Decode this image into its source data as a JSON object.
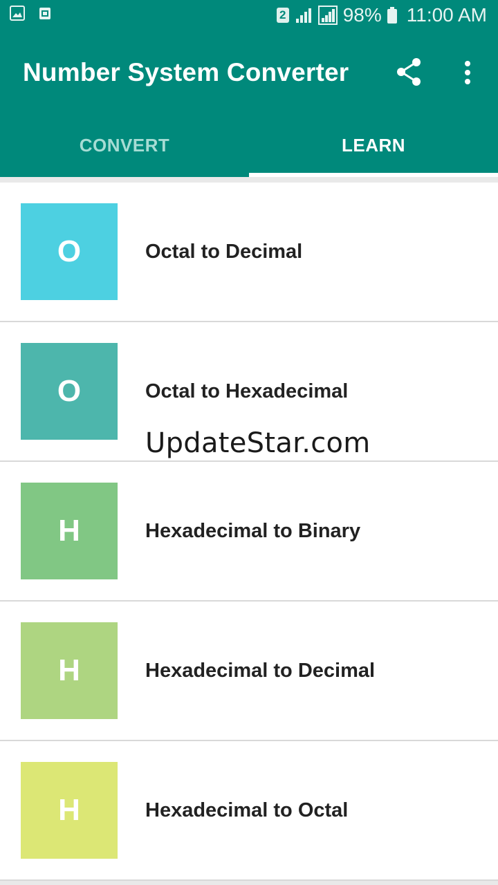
{
  "status_bar": {
    "sim_slot": "2",
    "battery": "98%",
    "time": "11:00 AM",
    "icons": [
      "gallery-icon",
      "app-notification-icon",
      "signal-icon",
      "signal-icon-2",
      "battery-icon"
    ]
  },
  "app_bar": {
    "title": "Number System Converter",
    "actions": [
      "share-icon",
      "more-vert-icon"
    ],
    "color": "#00897b"
  },
  "tabs": [
    {
      "label": "CONVERT",
      "selected": false
    },
    {
      "label": "LEARN",
      "selected": true
    }
  ],
  "items": [
    {
      "letter": "O",
      "label": "Octal to Decimal",
      "color": "#4dd0e1"
    },
    {
      "letter": "O",
      "label": "Octal to Hexadecimal",
      "color": "#4db6ac"
    },
    {
      "letter": "H",
      "label": "Hexadecimal to Binary",
      "color": "#81c784"
    },
    {
      "letter": "H",
      "label": "Hexadecimal to Decimal",
      "color": "#aed581"
    },
    {
      "letter": "H",
      "label": "Hexadecimal to Octal",
      "color": "#dce775"
    }
  ],
  "watermark": "UpdateStar.com"
}
